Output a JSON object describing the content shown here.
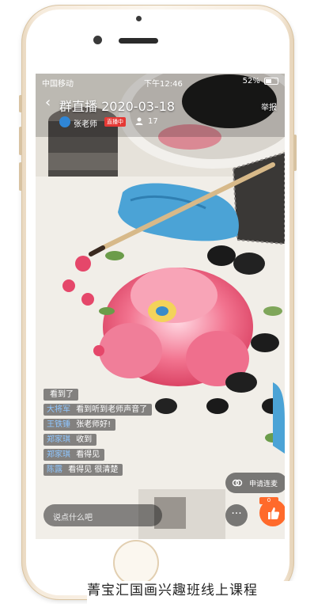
{
  "status_bar": {
    "carrier": "中国移动",
    "time": "下午12:46",
    "battery": "52%"
  },
  "header": {
    "back_icon": "chevron-left-icon",
    "title": "群直播 2020-03-18",
    "report_label": "举报",
    "host_name": "张老师",
    "live_badge": "直播中",
    "viewer_count": "17"
  },
  "comments": [
    {
      "user": "",
      "text": "看到了"
    },
    {
      "user": "大将军",
      "text": "看到听到老师声音了"
    },
    {
      "user": "王铁锤",
      "text": "张老师好!"
    },
    {
      "user": "郑家琪",
      "text": "收到"
    },
    {
      "user": "郑家琪",
      "text": "看得见"
    },
    {
      "user": "陈露",
      "text": "看得见  很清楚"
    }
  ],
  "controls": {
    "apply_mic_label": "申请连麦",
    "input_placeholder": "说点什么吧",
    "more_label": "···",
    "like_count": "0"
  },
  "caption": "菁宝汇国画兴趣班线上课程",
  "colors": {
    "like_button": "#ff6a2b",
    "live_badge": "#e53935",
    "phone_gold": "#f6ebdc"
  }
}
